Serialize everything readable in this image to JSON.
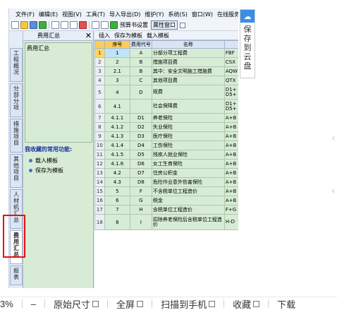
{
  "app": {
    "menu": [
      "文件(F)",
      "编辑(E)",
      "视图(V)",
      "工具(T)",
      "导入导出(D)",
      "维护(Y)",
      "系统(S)",
      "窗口(W)",
      "在线服务"
    ],
    "toolbar": {
      "budget_label": "预算书设置",
      "window_button": "属性窗口"
    },
    "vtabs": [
      "工程概况",
      "分部分项",
      "措施项目",
      "其他项目",
      "人材机汇总",
      "费用汇总",
      "报表"
    ],
    "left_panel": {
      "title": "费用汇总",
      "close": "✕",
      "tree_item": "费用汇总",
      "common_title": "我收藏的常用功能:",
      "functions": [
        "载入模板",
        "保存为模板"
      ]
    },
    "main_toolbar": [
      "插入",
      "保存为模板",
      "载入模板"
    ],
    "table": {
      "columns": [
        "序号",
        "费用代号",
        "名称",
        ""
      ],
      "rows": [
        {
          "rn": "1",
          "no": "1",
          "code": "A",
          "name": "分部分项工程费",
          "base": "FBF"
        },
        {
          "rn": "2",
          "no": "2",
          "code": "B",
          "name": "措施项目费",
          "base": "CSX"
        },
        {
          "rn": "3",
          "no": "2.1",
          "code": "B",
          "name": "其中：安全文明施工措施费",
          "base": "AQW"
        },
        {
          "rn": "4",
          "no": "3",
          "code": "C",
          "name": "其他项目费",
          "base": "QTX"
        },
        {
          "rn": "5",
          "no": "4",
          "code": "D",
          "name": "规费",
          "base": "D1+D5+"
        },
        {
          "rn": "6",
          "no": "4.1",
          "code": "",
          "name": "社会保障费",
          "base": "D1+D5+"
        },
        {
          "rn": "7",
          "no": "4.1.1",
          "code": "D1",
          "name": "养老保险",
          "base": "A+B"
        },
        {
          "rn": "8",
          "no": "4.1.2",
          "code": "D2",
          "name": "失业保险",
          "base": "A+B"
        },
        {
          "rn": "9",
          "no": "4.1.3",
          "code": "D3",
          "name": "医疗保险",
          "base": "A+B"
        },
        {
          "rn": "10",
          "no": "4.1.4",
          "code": "D4",
          "name": "工伤保险",
          "base": "A+B"
        },
        {
          "rn": "11",
          "no": "4.1.5",
          "code": "D5",
          "name": "残疾人就业保险",
          "base": "A+B"
        },
        {
          "rn": "12",
          "no": "4.1.6",
          "code": "D6",
          "name": "女工生育保险",
          "base": "A+B"
        },
        {
          "rn": "13",
          "no": "4.2",
          "code": "D7",
          "name": "住房公积金",
          "base": "A+B"
        },
        {
          "rn": "14",
          "no": "4.3",
          "code": "D8",
          "name": "危险作业意外伤害保险",
          "base": "A+B"
        },
        {
          "rn": "15",
          "no": "5",
          "code": "F",
          "name": "不含税单位工程造价",
          "base": "A+B"
        },
        {
          "rn": "16",
          "no": "6",
          "code": "G",
          "name": "税金",
          "base": "A+B"
        },
        {
          "rn": "17",
          "no": "7",
          "code": "H",
          "name": "含税单位工程造价",
          "base": "F+G"
        },
        {
          "rn": "18",
          "no": "8",
          "code": "I",
          "name": "扣除养老保险后含税单位工程造价",
          "base": "H-D"
        }
      ]
    }
  },
  "cloud": {
    "label": "保存到云盘",
    "icon": "cloud-icon"
  },
  "viewer_bar": {
    "zoom": "3%",
    "minus": "–",
    "original_size": "原始尺寸",
    "fullscreen": "全屏",
    "scan_to_phone": "扫描到手机",
    "favorite": "收藏",
    "download": "下载"
  }
}
